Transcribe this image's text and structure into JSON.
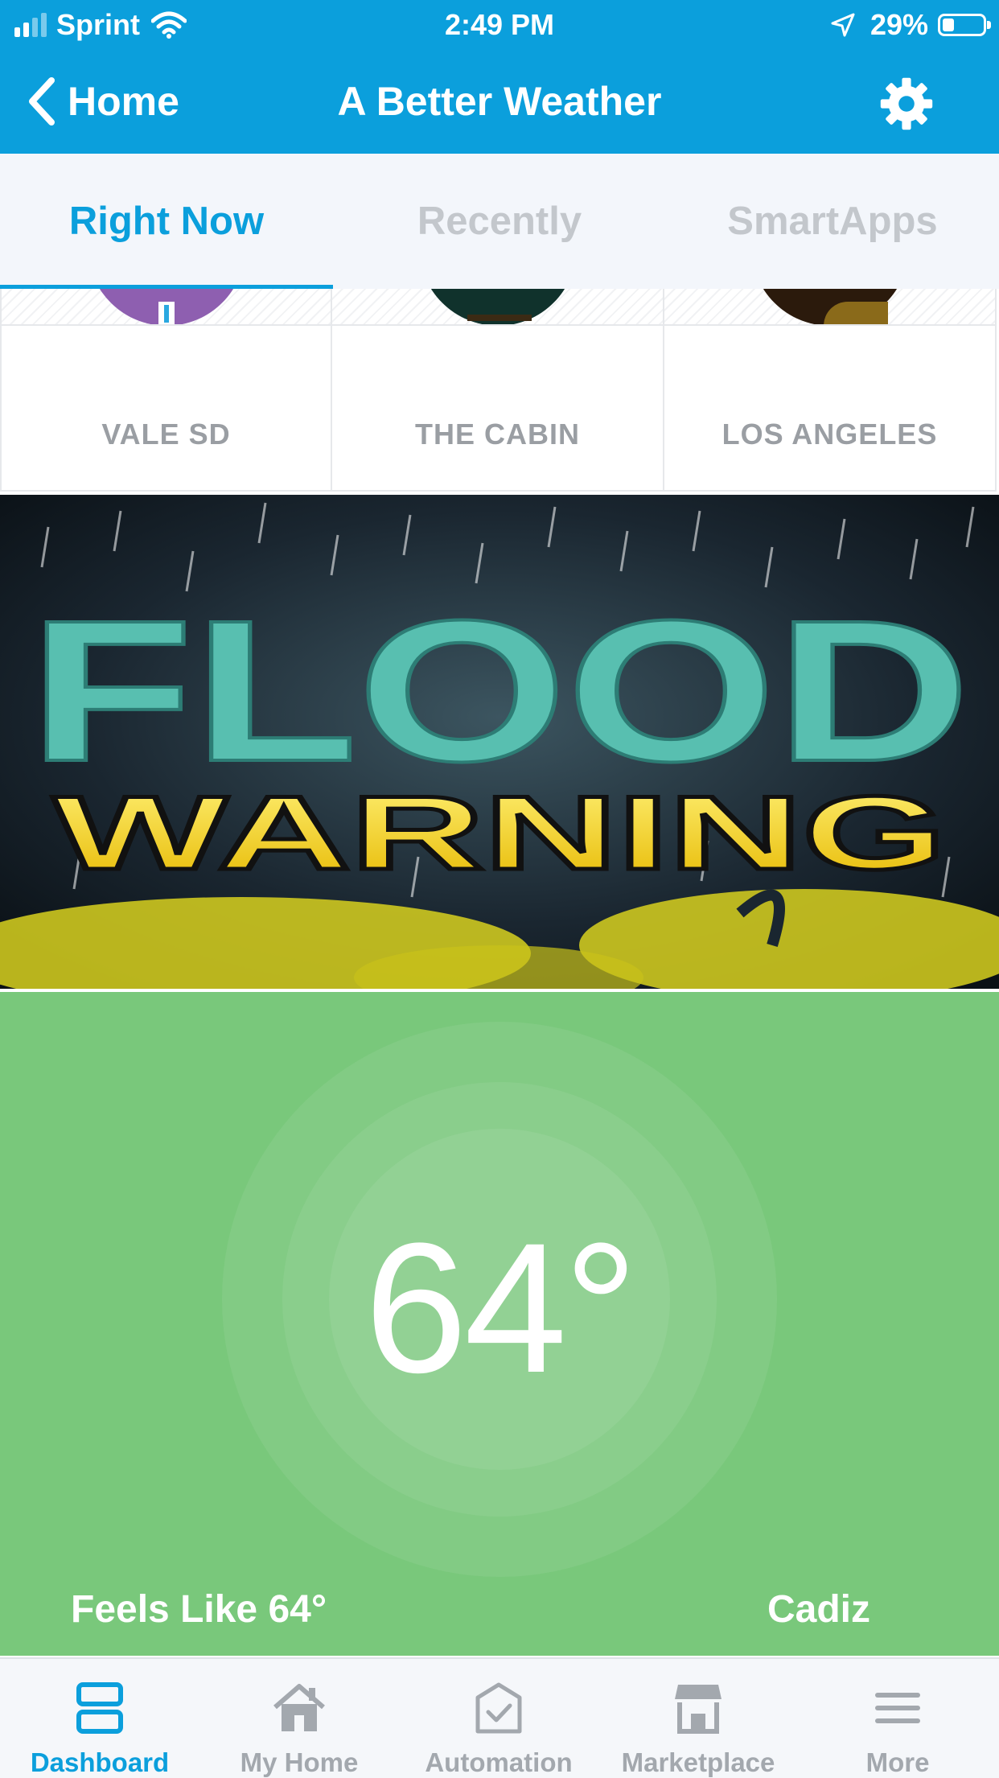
{
  "status_bar": {
    "carrier": "Sprint",
    "time": "2:49 PM",
    "battery": "29%",
    "battery_level": 0.29
  },
  "nav": {
    "back_label": "Home",
    "title": "A Better Weather"
  },
  "tabs": [
    {
      "label": "Right Now",
      "active": true
    },
    {
      "label": "Recently",
      "active": false
    },
    {
      "label": "SmartApps",
      "active": false
    }
  ],
  "locations": [
    {
      "name": "VALE SD",
      "thumb_color": "#8e5fb0"
    },
    {
      "name": "THE CABIN",
      "thumb_color": "#10322c"
    },
    {
      "name": "LOS ANGELES",
      "thumb_color": "#2b1a0c"
    }
  ],
  "banner": {
    "line1": "FLOOD",
    "line2": "WARNING"
  },
  "weather": {
    "temperature": "64°",
    "feels_like": "Feels Like 64°",
    "city": "Cadiz",
    "card_color": "#79c87b"
  },
  "tab_bar": [
    {
      "label": "Dashboard",
      "icon": "dashboard-icon",
      "active": true
    },
    {
      "label": "My Home",
      "icon": "home-icon",
      "active": false
    },
    {
      "label": "Automation",
      "icon": "automation-icon",
      "active": false
    },
    {
      "label": "Marketplace",
      "icon": "marketplace-icon",
      "active": false
    },
    {
      "label": "More",
      "icon": "menu-icon",
      "active": false
    }
  ],
  "colors": {
    "accent": "#0b9fdc",
    "inactive": "#a3a8ae"
  }
}
